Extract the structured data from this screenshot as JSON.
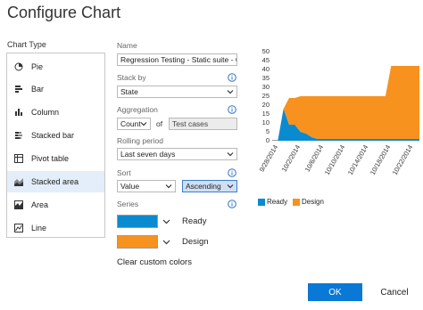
{
  "dialog": {
    "title": "Configure Chart",
    "ok_label": "OK",
    "cancel_label": "Cancel"
  },
  "chart_type": {
    "label": "Chart Type",
    "items": [
      {
        "label": "Pie",
        "icon": "pie-icon"
      },
      {
        "label": "Bar",
        "icon": "bar-icon"
      },
      {
        "label": "Column",
        "icon": "column-icon"
      },
      {
        "label": "Stacked bar",
        "icon": "stacked-bar-icon"
      },
      {
        "label": "Pivot table",
        "icon": "pivot-table-icon"
      },
      {
        "label": "Stacked area",
        "icon": "stacked-area-icon"
      },
      {
        "label": "Area",
        "icon": "area-icon"
      },
      {
        "label": "Line",
        "icon": "line-icon"
      }
    ],
    "selected": "Stacked area"
  },
  "form": {
    "name_label": "Name",
    "name_value": "Regression Testing - Static suite - Ch",
    "stack_by_label": "Stack by",
    "stack_by_value": "State",
    "aggregation_label": "Aggregation",
    "aggregation_value": "Count",
    "of_label": "of",
    "aggregation_field": "Test cases",
    "rolling_label": "Rolling period",
    "rolling_value": "Last seven days",
    "sort_label": "Sort",
    "sort_field": "Value",
    "sort_order": "Ascending",
    "series_label": "Series",
    "series": [
      {
        "name": "Ready",
        "color": "#0a8bd0"
      },
      {
        "name": "Design",
        "color": "#f7921e"
      }
    ],
    "clear_label": "Clear custom colors"
  },
  "chart_data": {
    "type": "area",
    "stacked": true,
    "x": [
      "9/28/2014",
      "9/29/2014",
      "9/30/2014",
      "10/1/2014",
      "10/2/2014",
      "10/3/2014",
      "10/4/2014",
      "10/5/2014",
      "10/6/2014",
      "10/7/2014",
      "10/8/2014",
      "10/9/2014",
      "10/10/2014",
      "10/11/2014",
      "10/12/2014",
      "10/13/2014",
      "10/14/2014",
      "10/15/2014",
      "10/16/2014",
      "10/17/2014",
      "10/18/2014",
      "10/19/2014",
      "10/20/2014",
      "10/21/2014",
      "10/22/2014",
      "10/23/2014",
      "10/24/2014"
    ],
    "x_tick_labels": [
      "9/28/2014",
      "10/2/2014",
      "10/6/2014",
      "10/10/2014",
      "10/14/2014",
      "10/18/2014",
      "10/22/2014"
    ],
    "series": [
      {
        "name": "Ready",
        "color": "#0a8bd0",
        "values": [
          0,
          0,
          18,
          9,
          9,
          5,
          4,
          2,
          1,
          1,
          1,
          1,
          1,
          1,
          1,
          1,
          1,
          1,
          1,
          1,
          1,
          1,
          1,
          1,
          1,
          1,
          1
        ]
      },
      {
        "name": "Design",
        "color": "#f7921e",
        "values": [
          0,
          0,
          0,
          15,
          15,
          20,
          21,
          23,
          24,
          24,
          24,
          24,
          24,
          24,
          24,
          24,
          24,
          24,
          24,
          24,
          24,
          41,
          41,
          41,
          41,
          41,
          41
        ]
      }
    ],
    "y_ticks": [
      0,
      5,
      10,
      15,
      20,
      25,
      30,
      35,
      40,
      45,
      50
    ],
    "ylim": [
      0,
      50
    ],
    "legend": "bottom"
  }
}
